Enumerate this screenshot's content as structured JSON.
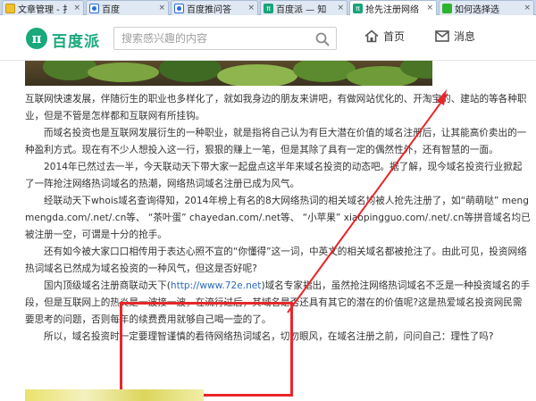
{
  "tabs": [
    {
      "label": "文章管理 - 扌",
      "favicon": "doc-icon",
      "close": "×"
    },
    {
      "label": "百度",
      "favicon": "baidu-paw-icon",
      "close": "×"
    },
    {
      "label": "百度推问答",
      "favicon": "baidu-paw-icon",
      "close": "×"
    },
    {
      "label": "百度派 — 知",
      "favicon": "baidupai-icon",
      "close": "×"
    },
    {
      "label": "抢先注册网络",
      "favicon": "baidupai-icon",
      "close": "×",
      "active": true
    },
    {
      "label": "如何选择选",
      "favicon": "green-icon",
      "close": "×"
    }
  ],
  "header": {
    "logo_symbol": "π",
    "logo_text": "百度派",
    "search_placeholder": "搜索感兴趣的内容",
    "nav_home": "首页",
    "nav_messages": "消息",
    "accent_color": "#19a97b"
  },
  "article": {
    "p1": "互联网快速发展，伴随衍生的职业也多样化了，就如我身边的朋友来讲吧，有做网站优化的、开淘宝的、建站的等各种职业，但是不管是怎样都和互联网有所挂钩。",
    "p2": "而域名投资也是互联网发展衍生的一种职业，就是指将自己认为有巨大潜在价值的域名注册后，让其能高价卖出的一种盈利方式。现在有不少人想投入这一行，狠狠的赚上一笔，但是其除了具有一定的偶然性外，还有智慧的一面。",
    "p3": "2014年已然过去一半，今天联动天下带大家一起盘点这半年来域名投资的动态吧。据了解，现今域名投资行业掀起了一阵抢注网络热词域名的热潮，网络热词域名注册已成为风气。",
    "p4": "经联动天下whois域名查询得知，2014年榜上有名的8大网络热词的相关域名均被人抢先注册了，如“萌萌哒” mengmengda.com/.net/.cn等、 “茶叶蛋” chayedan.com/.net等、 “小苹果” xiaopingguo.com/.net/.cn等拼音域名均已被注册一空，可谓是十分的抢手。",
    "p5": "还有如今被大家口口相传用于表达心照不宣的“你懂得”这一词，中英文的相关域名都被抢注了。由此可见，投资网络热词域名已然成为域名投资的一种风气，但这是否好呢?",
    "p6_a": "国内顶级域名注册商联动天下(",
    "p6_link": "http://www.72e.net",
    "p6_b": ")域名专家指出，虽然抢注网络热词域名不乏是一种投资域名的手段，但是互联网上的热炎是一波接一波，在流行过后，其域名是否还具有其它的潜在的价值呢?这是热爱域名投资网民需要思考的问题，否则每年的续费费用就够自己喝一壶的了。",
    "p7": "所以，域名投资时一定要理智谨慎的看待网络热词域名，切勿眼风，在域名注册之前，问问自己：理性了吗?"
  },
  "annotation": {
    "color": "#e8262a"
  }
}
